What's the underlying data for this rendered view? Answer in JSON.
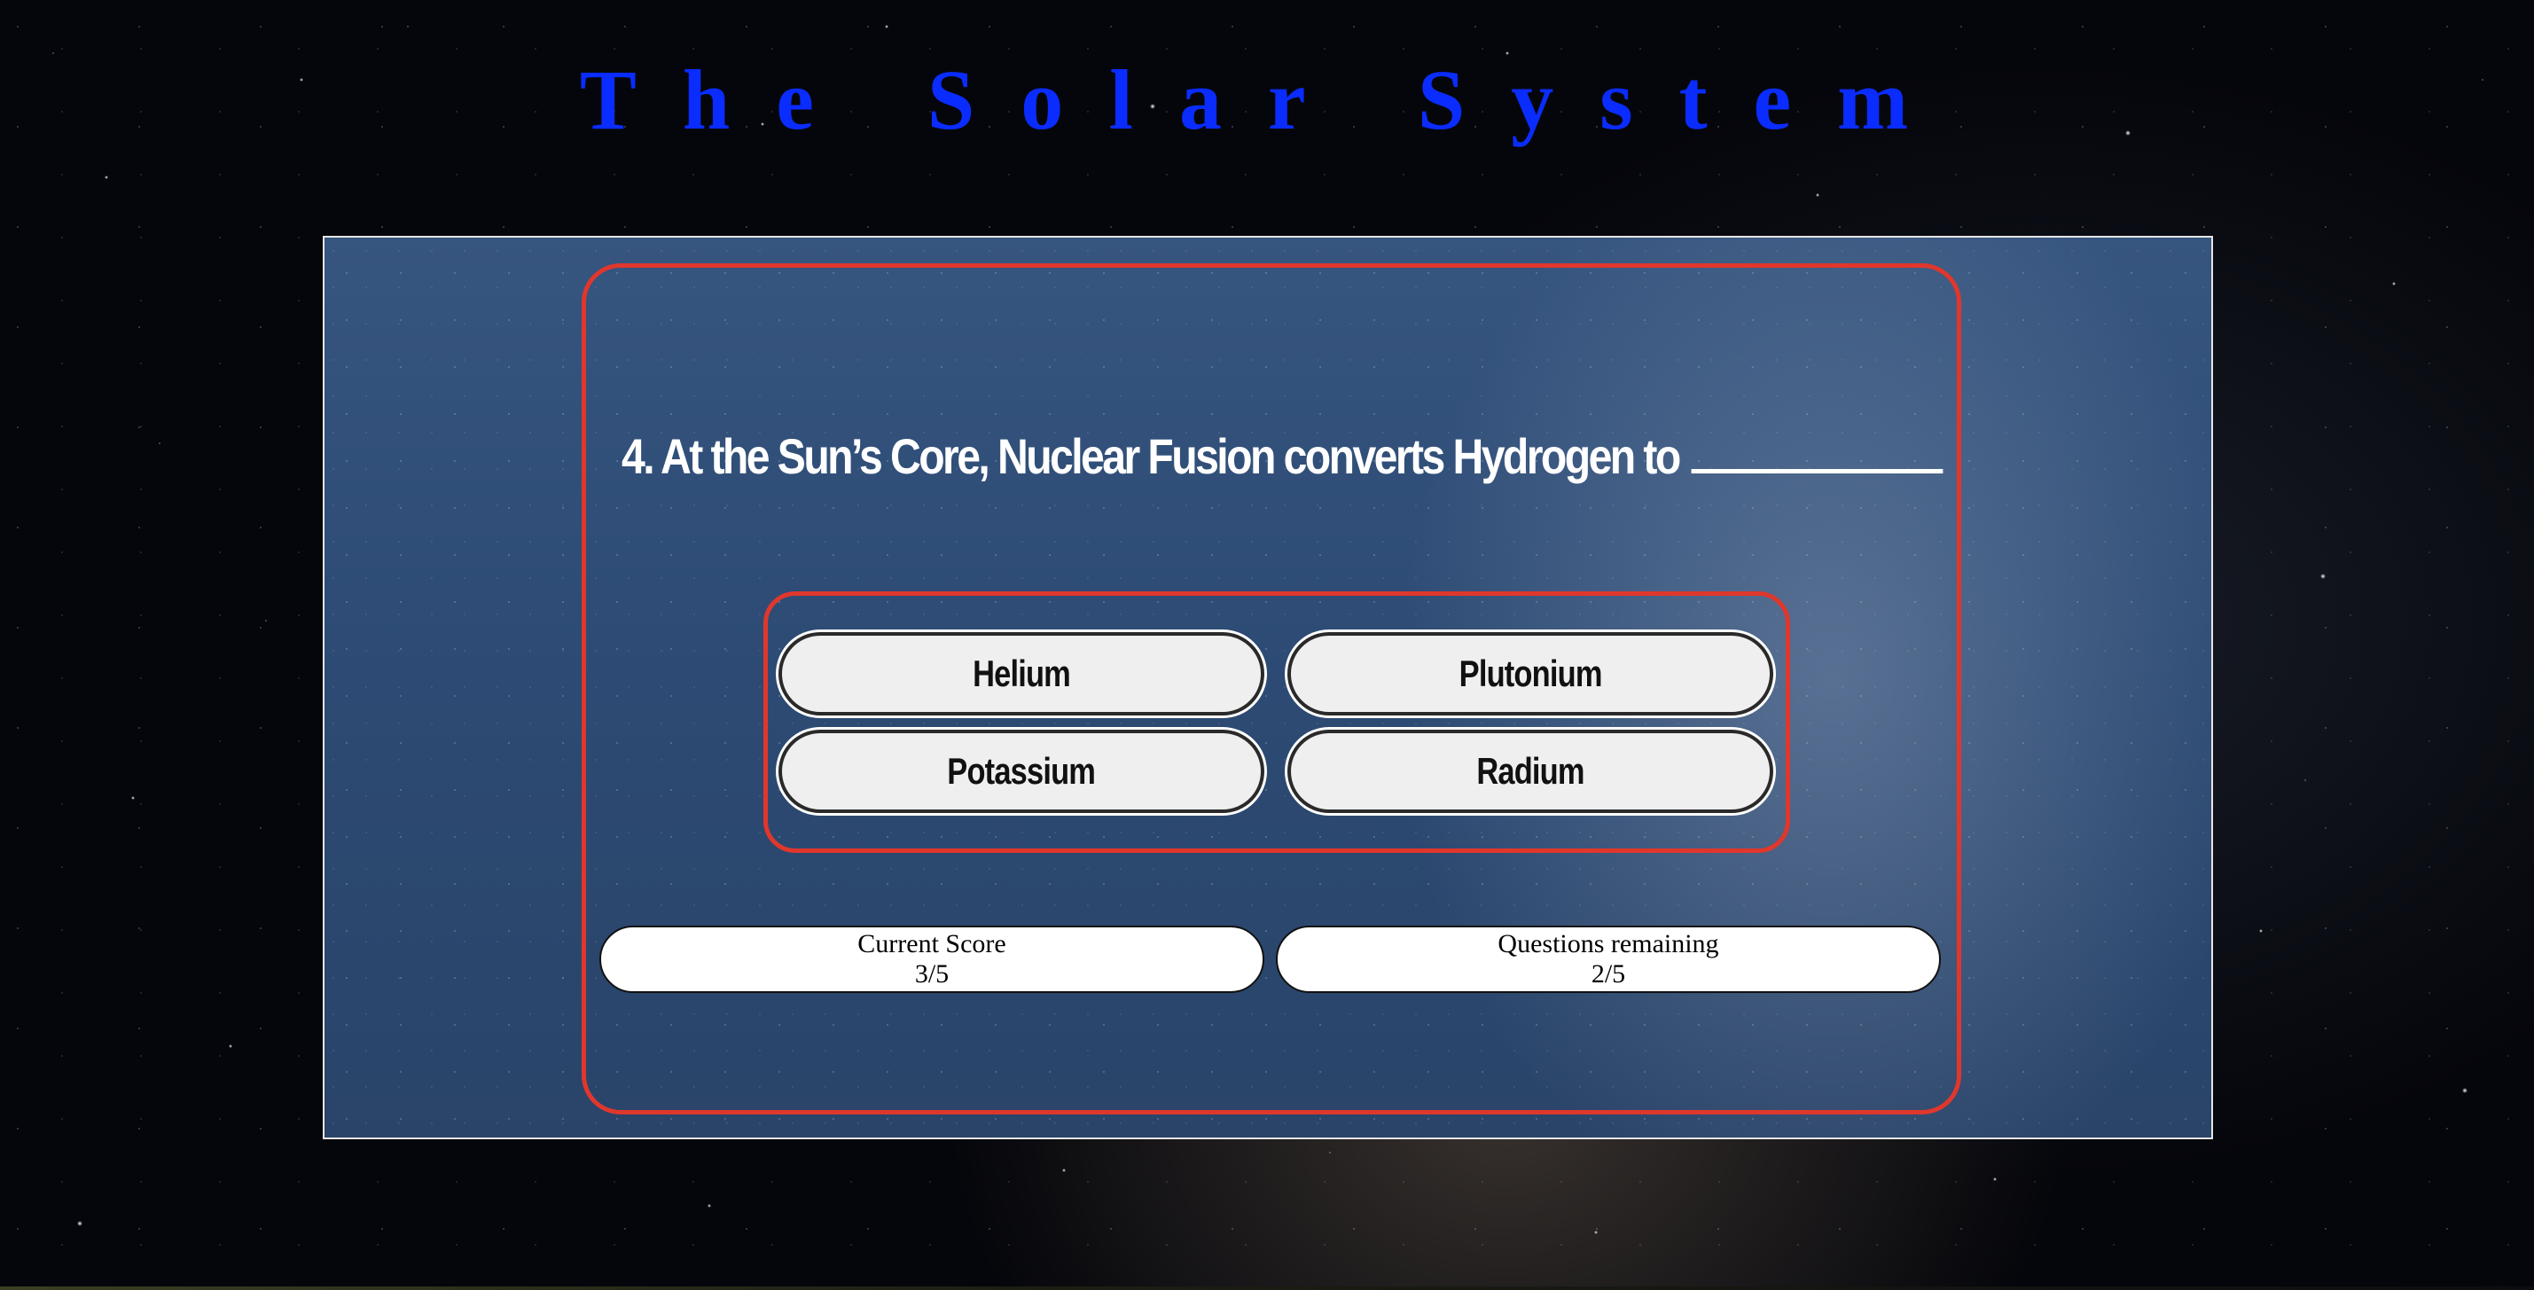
{
  "site": {
    "title": "The Solar System"
  },
  "quiz": {
    "question": "4. At the Sun’s Core, Nuclear Fusion converts Hydrogen to",
    "answers": [
      {
        "label": "Helium"
      },
      {
        "label": "Plutonium"
      },
      {
        "label": "Potassium"
      },
      {
        "label": "Radium"
      }
    ],
    "score": {
      "label": "Current Score",
      "value": "3/5"
    },
    "remaining": {
      "label": "Questions remaining",
      "value": "2/5"
    }
  },
  "colors": {
    "title": "#0a2cff",
    "accent_border": "#e0372d",
    "panel_bg": "#2c4a73",
    "button_bg": "#efefef"
  }
}
